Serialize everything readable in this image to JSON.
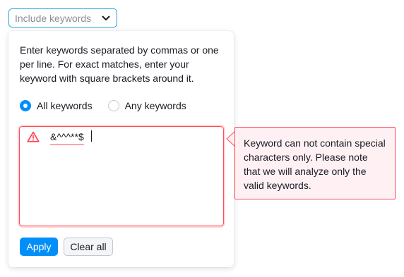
{
  "trigger": {
    "label": "Include keywords",
    "icon": "chevron-down-icon"
  },
  "dropdown": {
    "help_text": "Enter keywords separated by commas or one per line. For exact matches, enter your keyword with square brackets around it.",
    "match_mode": {
      "options": [
        {
          "label": "All keywords",
          "checked": true
        },
        {
          "label": "Any keywords",
          "checked": false
        }
      ]
    },
    "keywords_input": {
      "value": "&^^^**$",
      "state": "error",
      "icon": "warning-icon"
    },
    "buttons": {
      "apply_label": "Apply",
      "clear_label": "Clear all"
    }
  },
  "error_tooltip": {
    "text": "Keyword can not contain special characters only. Please note that we will analyze only the valid keywords."
  },
  "colors": {
    "accent": "#008ff8",
    "trigger_border": "#1ea0dc",
    "error": "#ff4d57",
    "error_bg": "#fff0f4",
    "text": "#191b23",
    "muted": "#8a8e9b"
  }
}
